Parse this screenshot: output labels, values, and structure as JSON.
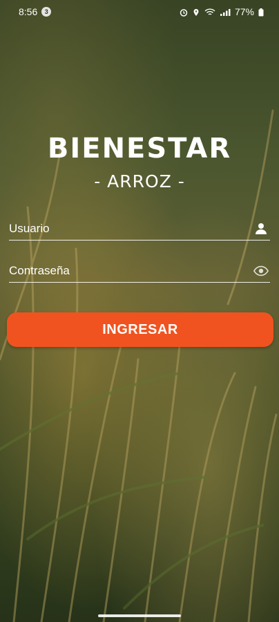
{
  "status_bar": {
    "time": "8:56",
    "notification_badge": "3",
    "battery": "77%",
    "icons": [
      "alarm-icon",
      "location-icon",
      "wifi-icon",
      "signal-icon",
      "battery-icon"
    ]
  },
  "brand": {
    "title": "BIENESTAR",
    "subtitle": "- ARROZ -"
  },
  "form": {
    "username_placeholder": "Usuario",
    "username_icon": "person-icon",
    "password_placeholder": "Contraseña",
    "password_icon": "eye-icon",
    "submit_label": "INGRESAR"
  },
  "colors": {
    "accent": "#f0531f",
    "text": "#ffffff"
  }
}
